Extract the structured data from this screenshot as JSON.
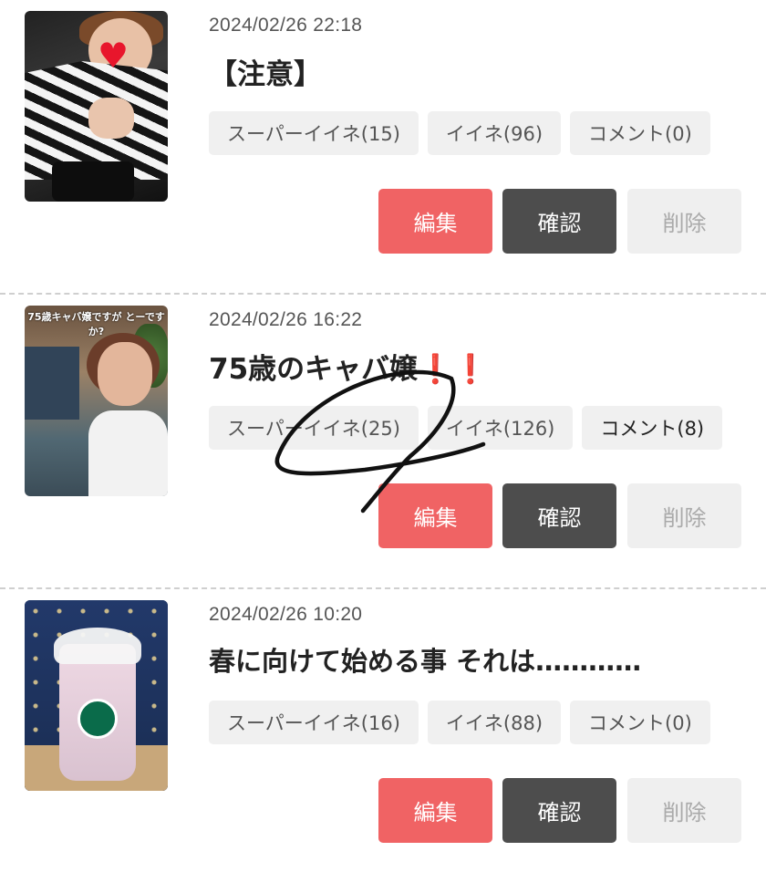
{
  "posts": [
    {
      "date": "2024/02/26 22:18",
      "title": "【注意】",
      "chips": {
        "super_like": "スーパーイイネ(15)",
        "like": "イイネ(96)",
        "comment": "コメント(0)"
      },
      "buttons": {
        "edit": "編集",
        "confirm": "確認",
        "delete": "削除"
      }
    },
    {
      "date": "2024/02/26 16:22",
      "title": "75歳のキャバ嬢",
      "title_suffix": "❗️❗️",
      "thumb_caption": "75歳キャバ嬢ですが とーですか?",
      "chips": {
        "super_like": "スーパーイイネ(25)",
        "like": "イイネ(126)",
        "comment": "コメント(8)"
      },
      "buttons": {
        "edit": "編集",
        "confirm": "確認",
        "delete": "削除"
      }
    },
    {
      "date": "2024/02/26 10:20",
      "title": "春に向けて始める事 それは…………",
      "chips": {
        "super_like": "スーパーイイネ(16)",
        "like": "イイネ(88)",
        "comment": "コメント(0)"
      },
      "buttons": {
        "edit": "編集",
        "confirm": "確認",
        "delete": "削除"
      }
    }
  ],
  "colors": {
    "edit_button": "#f06364",
    "confirm_button": "#4d4d4d",
    "delete_button": "#efefef",
    "chip_bg": "#f0f0f0",
    "exclamation": "#e0231f"
  },
  "icons": {
    "post1_thumb": "heart-sticker-photo",
    "post3_thumb": "drink-cup-photo"
  }
}
